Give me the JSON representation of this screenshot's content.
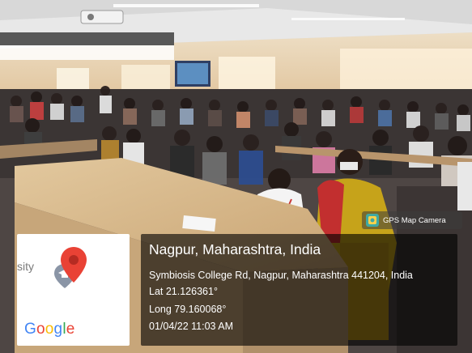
{
  "badge": {
    "label": "GPS Map Camera",
    "icon": "gps-map-camera-icon"
  },
  "map": {
    "partial_label": "sity",
    "logo": "Google",
    "pin_color": "#e94235",
    "icon": "graduation-cap-icon"
  },
  "location": {
    "title": "Nagpur, Maharashtra, India",
    "address": "Symbiosis College Rd, Nagpur, Maharashtra 441204, India",
    "lat": "Lat 21.126361°",
    "long": "Long 79.160068°",
    "datetime": "01/04/22 11:03 AM"
  }
}
